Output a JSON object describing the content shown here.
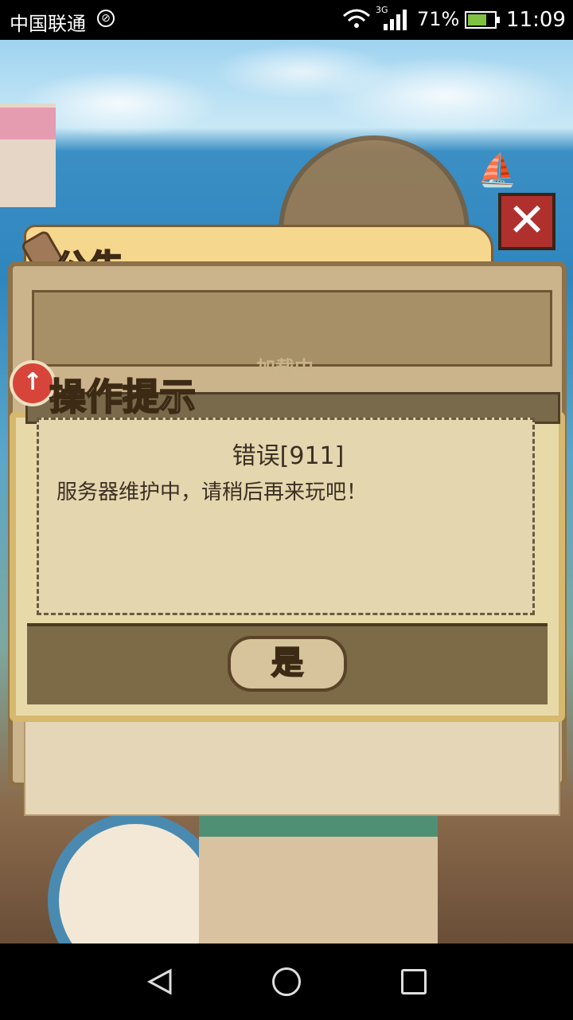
{
  "status_bar": {
    "carrier": "中国联通",
    "network": "3G",
    "battery": "71%",
    "battery_level": 0.71,
    "time": "11:09",
    "icons": [
      "no-sim-icon",
      "wifi-icon",
      "signal-icon",
      "battery-icon"
    ]
  },
  "announcement": {
    "title": "公告",
    "loading": "加载中...",
    "close_icon": "close-icon"
  },
  "dialog": {
    "header": "操作提示",
    "badge_glyph": "↑",
    "error_title": "错误[911]",
    "error_message": "服务器维护中，请稍后再来玩吧！",
    "confirm_label": "是"
  },
  "nav_bar": {
    "icons": [
      "back-icon",
      "home-icon",
      "recent-apps-icon"
    ]
  },
  "colors": {
    "close_button": "#b0302e",
    "badge": "#d7453a",
    "battery_fill": "#7fc242"
  }
}
